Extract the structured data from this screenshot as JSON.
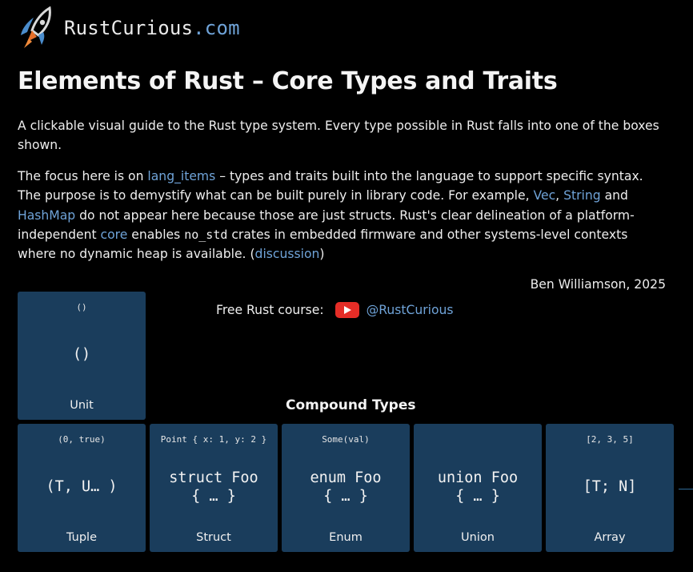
{
  "header": {
    "brand": "RustCurious",
    "tld": ".com"
  },
  "title": "Elements of Rust – Core Types and Traits",
  "intro": {
    "p1": "A clickable visual guide to the Rust type system. Every type possible in Rust falls into one of the boxes shown.",
    "p2": {
      "t1": "The focus here is on ",
      "link_lang_items": "lang_items",
      "t2": " – types and traits built into the language to support specific syntax. The purpose is to demystify what can be built purely in library code. For example, ",
      "link_vec": "Vec",
      "t3": ", ",
      "link_string": "String",
      "t4": " and ",
      "link_hashmap": "HashMap",
      "t5": " do not appear here because those are just structs. Rust's clear delineation of a platform-independent ",
      "link_core": "core",
      "t6": " enables ",
      "code_no_std": "no_std",
      "t7": " crates in embedded firmware and other systems-level contexts where no dynamic heap is available. (",
      "link_discussion": "discussion",
      "t8": ")"
    }
  },
  "author": "Ben Williamson, 2025",
  "course": {
    "label": "Free Rust course:",
    "icon": "youtube-icon",
    "link": "@RustCurious"
  },
  "unit_box": {
    "example": "()",
    "code": "()",
    "name": "Unit"
  },
  "compound": {
    "title": "Compound Types",
    "boxes": [
      {
        "example": "(0, true)",
        "code1": "(T, U… )",
        "code2": "",
        "name": "Tuple"
      },
      {
        "example": "Point { x: 1, y: 2 }",
        "code1": "struct Foo",
        "code2": "{ … }",
        "name": "Struct"
      },
      {
        "example": "Some(val)",
        "code1": "enum Foo",
        "code2": "{ … }",
        "name": "Enum"
      },
      {
        "example": "",
        "code1": "union Foo",
        "code2": "{ … }",
        "name": "Union"
      },
      {
        "example": "[2, 3, 5]",
        "code1": "[T; N]",
        "code2": "",
        "name": "Array"
      }
    ]
  },
  "colors": {
    "background": "#000000",
    "box": "#1a3d5c",
    "link": "#6fa3d8",
    "youtube": "#e52d27"
  }
}
